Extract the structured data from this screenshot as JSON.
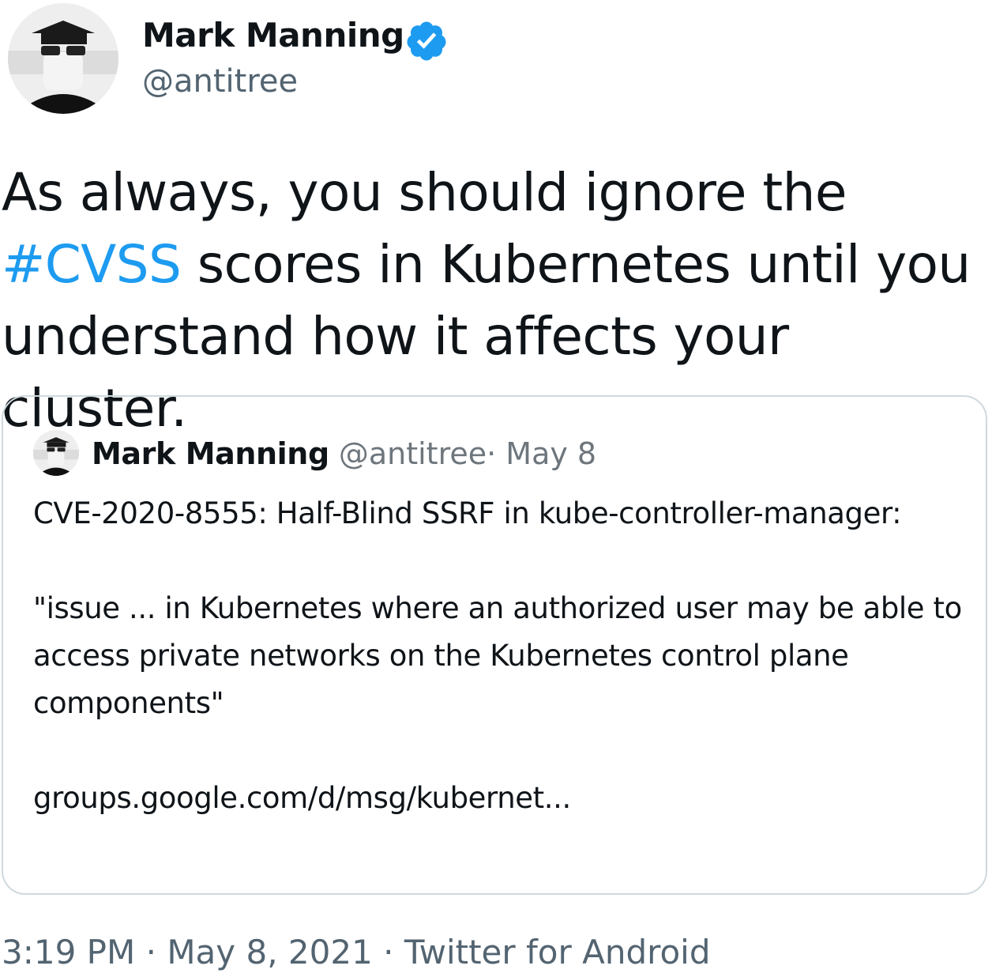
{
  "author": {
    "name": "Mark Manning",
    "handle": "@antitree",
    "verified": true,
    "avatar_icon": "profile-photo"
  },
  "tweet": {
    "text_before_hashtag": "As always, you should ignore the",
    "hashtag": "#CVSS",
    "text_after_hashtag": " scores in Kubernetes until you understand how it affects your cluster."
  },
  "quoted_tweet": {
    "author_name": "Mark Manning",
    "handle": "@antitree",
    "separator_date": "· May 8",
    "line1": "CVE-2020-8555: Half-Blind SSRF in kube-controller-manager:",
    "line2": "\"issue ... in Kubernetes where an authorized user may be able to access private networks on the Kubernetes control plane components\"",
    "link": "groups.google.com/d/msg/kubernet..."
  },
  "footer": {
    "time": "3:19 PM",
    "date": "May 8, 2021",
    "source": "Twitter for Android",
    "separator": "·"
  },
  "colors": {
    "text": "#0f1419",
    "secondary": "#536471",
    "hashtag": "#1d9bf0",
    "verified": "#1d9bf0",
    "border": "#cfd9de"
  }
}
